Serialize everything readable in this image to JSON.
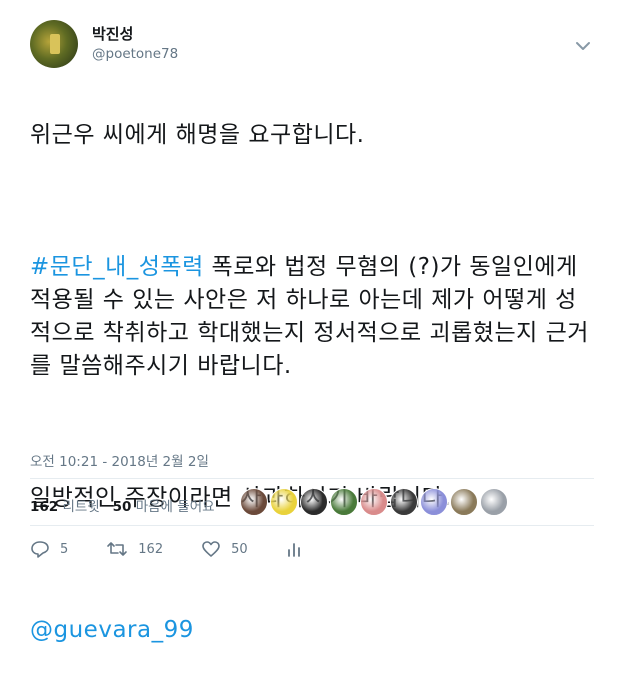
{
  "user": {
    "name": "박진성",
    "handle": "@poetone78"
  },
  "tweet": {
    "p1": "위근우 씨에게 해명을 요구합니다.",
    "hashtag": "#문단_내_성폭력",
    "p2_rest": " 폭로와 법정 무혐의 (?)가 동일인에게 적용될 수 있는 사안은 저 하나로 아는데 제가 어떻게 성적으로 착취하고 학대했는지 정서적으로 괴롭혔는지 근거를 말씀해주시기 바랍니다.",
    "p3": "일방적인 주장이라면 사과하시기 바랍니다.",
    "mention": "@guevara_99"
  },
  "timestamp": "오전 10:21 - 2018년 2월 2일",
  "stats": {
    "retweets_count": "162",
    "retweets_label": "리트윗",
    "likes_count": "50",
    "likes_label": "마음에 들어요"
  },
  "actions": {
    "reply_count": "5",
    "retweet_count": "162",
    "like_count": "50"
  },
  "icons": {
    "reply": "reply-icon",
    "retweet": "retweet-icon",
    "like": "heart-icon",
    "analytics": "analytics-icon",
    "menu": "chevron-down-icon"
  },
  "colors": {
    "link": "#1b95e0",
    "muted": "#657786",
    "text": "#14171a"
  },
  "likers": [
    "#6b4a3a",
    "#e9d23b",
    "#2b2b2b",
    "#4a7a3a",
    "#d98b8b",
    "#3a3a3a",
    "#8b8fd9",
    "#8a7a5a",
    "#9aa0a8"
  ]
}
